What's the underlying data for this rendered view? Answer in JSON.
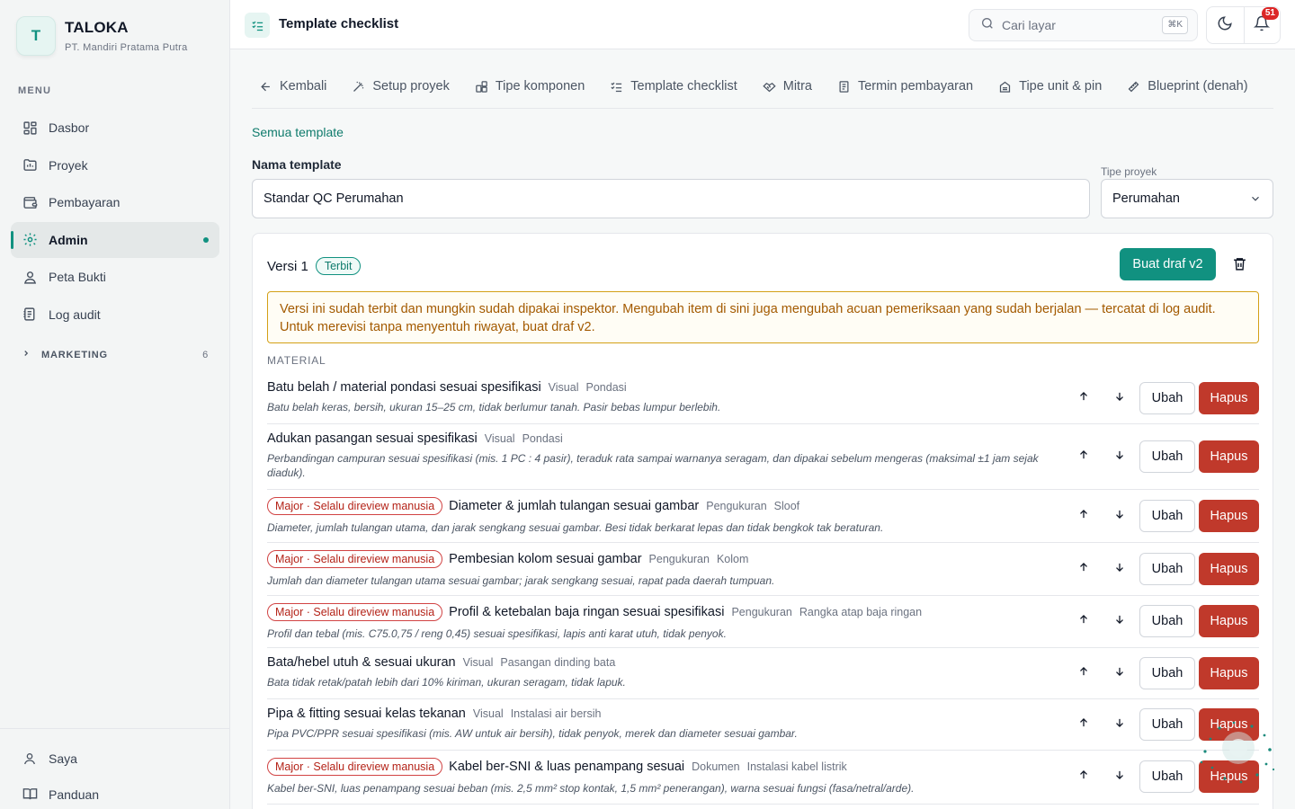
{
  "sidebar": {
    "brand_initial": "T",
    "brand_name": "TALOKA",
    "brand_sub": "PT. Mandiri Pratama Putra",
    "menu_label": "MENU",
    "items": [
      {
        "label": "Dasbor",
        "icon": "dashboard-icon"
      },
      {
        "label": "Proyek",
        "icon": "folder-icon"
      },
      {
        "label": "Pembayaran",
        "icon": "wallet-icon"
      },
      {
        "label": "Admin",
        "icon": "gear-icon",
        "active": true
      },
      {
        "label": "Peta Bukti",
        "icon": "map-pin-user-icon"
      },
      {
        "label": "Log audit",
        "icon": "log-icon"
      }
    ],
    "marketing": {
      "label": "MARKETING",
      "count": "6"
    },
    "bottom": [
      {
        "label": "Saya",
        "icon": "user-icon"
      },
      {
        "label": "Panduan",
        "icon": "book-icon"
      }
    ]
  },
  "topbar": {
    "title": "Template checklist",
    "search_placeholder": "Cari layar",
    "search_shortcut": "⌘K",
    "notification_count": "51"
  },
  "tabs": [
    {
      "label": "Kembali",
      "icon": "arrow-left-icon"
    },
    {
      "label": "Setup proyek",
      "icon": "wand-icon"
    },
    {
      "label": "Tipe komponen",
      "icon": "components-icon"
    },
    {
      "label": "Template checklist",
      "icon": "checklist-icon"
    },
    {
      "label": "Mitra",
      "icon": "handshake-icon"
    },
    {
      "label": "Termin pembayaran",
      "icon": "receipt-icon"
    },
    {
      "label": "Tipe unit & pin",
      "icon": "building-icon"
    },
    {
      "label": "Blueprint (denah)",
      "icon": "ruler-icon"
    }
  ],
  "form": {
    "back_link": "Semua template",
    "name_label": "Nama template",
    "name_value": "Standar QC Perumahan",
    "type_label": "Tipe proyek",
    "type_value": "Perumahan"
  },
  "version": {
    "title": "Versi 1",
    "status": "Terbit",
    "draft_button": "Buat draf v2",
    "warning": "Versi ini sudah terbit dan mungkin sudah dipakai inspektor. Mengubah item di sini juga mengubah acuan pemeriksaan yang sudah berjalan — tercatat di log audit. Untuk merevisi tanpa menyentuh riwayat, buat draf v2.",
    "section": "MATERIAL",
    "edit_label": "Ubah",
    "delete_label": "Hapus",
    "items": [
      {
        "major": "",
        "title": "Batu belah / material pondasi sesuai spesifikasi",
        "method": "Visual",
        "component": "Pondasi",
        "desc": "Batu belah keras, bersih, ukuran 15–25 cm, tidak berlumur tanah. Pasir bebas lumpur berlebih."
      },
      {
        "major": "",
        "title": "Adukan pasangan sesuai spesifikasi",
        "method": "Visual",
        "component": "Pondasi",
        "desc": "Perbandingan campuran sesuai spesifikasi (mis. 1 PC : 4 pasir), teraduk rata sampai warnanya seragam, dan dipakai sebelum mengeras (maksimal ±1 jam sejak diaduk)."
      },
      {
        "major": "Major · Selalu direview manusia",
        "title": "Diameter & jumlah tulangan sesuai gambar",
        "method": "Pengukuran",
        "component": "Sloof",
        "desc": "Diameter, jumlah tulangan utama, dan jarak sengkang sesuai gambar. Besi tidak berkarat lepas dan tidak bengkok tak beraturan."
      },
      {
        "major": "Major · Selalu direview manusia",
        "title": "Pembesian kolom sesuai gambar",
        "method": "Pengukuran",
        "component": "Kolom",
        "desc": "Jumlah dan diameter tulangan utama sesuai gambar; jarak sengkang sesuai, rapat pada daerah tumpuan."
      },
      {
        "major": "Major · Selalu direview manusia",
        "title": "Profil & ketebalan baja ringan sesuai spesifikasi",
        "method": "Pengukuran",
        "component": "Rangka atap baja ringan",
        "desc": "Profil dan tebal (mis. C75.0,75 / reng 0,45) sesuai spesifikasi, lapis anti karat utuh, tidak penyok."
      },
      {
        "major": "",
        "title": "Bata/hebel utuh & sesuai ukuran",
        "method": "Visual",
        "component": "Pasangan dinding bata",
        "desc": "Bata tidak retak/patah lebih dari 10% kiriman, ukuran seragam, tidak lapuk."
      },
      {
        "major": "",
        "title": "Pipa & fitting sesuai kelas tekanan",
        "method": "Visual",
        "component": "Instalasi air bersih",
        "desc": "Pipa PVC/PPR sesuai spesifikasi (mis. AW untuk air bersih), tidak penyok, merek dan diameter sesuai gambar."
      },
      {
        "major": "Major · Selalu direview manusia",
        "title": "Kabel ber-SNI & luas penampang sesuai",
        "method": "Dokumen",
        "component": "Instalasi kabel listrik",
        "desc": "Kabel ber-SNI, luas penampang sesuai beban (mis. 2,5 mm² stop kontak, 1,5 mm² penerangan), warna sesuai fungsi (fasa/netral/arde)."
      }
    ]
  }
}
